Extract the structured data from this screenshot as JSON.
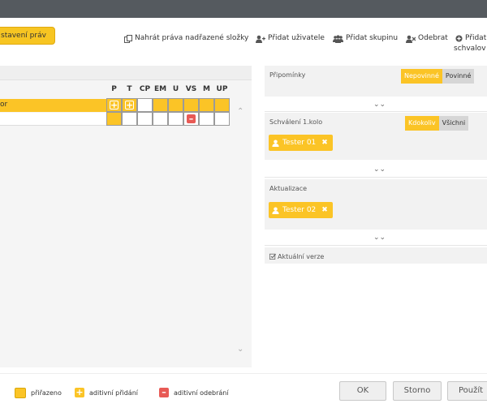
{
  "window": {
    "titlebar_color": "#555a5f"
  },
  "tab": {
    "label": "stavení práv"
  },
  "toolbar": {
    "items": [
      {
        "label": "Nahrát práva nadřazené složky",
        "icon": "copy-rights-icon"
      },
      {
        "label": "Přidat uživatele",
        "icon": "add-user-icon"
      },
      {
        "label": "Přidat skupinu",
        "icon": "add-group-icon"
      },
      {
        "label": "Odebrat",
        "icon": "remove-user-icon"
      },
      {
        "label": "Přidat",
        "label2": "schvalov",
        "icon": "add-circle-icon"
      }
    ]
  },
  "rights": {
    "columns": [
      "P",
      "T",
      "CP",
      "EM",
      "U",
      "VS",
      "M",
      "UP"
    ],
    "rows": [
      {
        "label": "or",
        "selected": true,
        "cells": [
          "plus",
          "plus",
          "empty",
          "yellow",
          "yellow",
          "yellow",
          "yellow",
          "yellow"
        ]
      },
      {
        "label": "",
        "selected": false,
        "cells": [
          "yellow",
          "empty",
          "empty",
          "empty",
          "empty",
          "minus",
          "empty",
          "empty"
        ]
      }
    ]
  },
  "approval": {
    "sections": [
      {
        "title": "Připomínky",
        "toggle": [
          "Nepovinné",
          "Povinné"
        ],
        "active": 0,
        "chips": []
      },
      {
        "title": "Schválení 1.kolo",
        "toggle": [
          "Kdokoliv",
          "Všichni"
        ],
        "active": 0,
        "chips": [
          "Tester 01"
        ]
      },
      {
        "title": "Aktualizace",
        "toggle": [],
        "active": -1,
        "chips": [
          "Tester 02"
        ]
      },
      {
        "title": "Aktuální verze",
        "toggle": [],
        "active": -1,
        "chips": []
      }
    ]
  },
  "legend": {
    "assigned": "přiřazeno",
    "added": "aditivní přidání",
    "removed": "aditivní odebrání"
  },
  "buttons": {
    "ok": "OK",
    "cancel": "Storno",
    "apply": "Použít"
  },
  "colors": {
    "accent": "#fbc426",
    "danger": "#e85a55"
  }
}
